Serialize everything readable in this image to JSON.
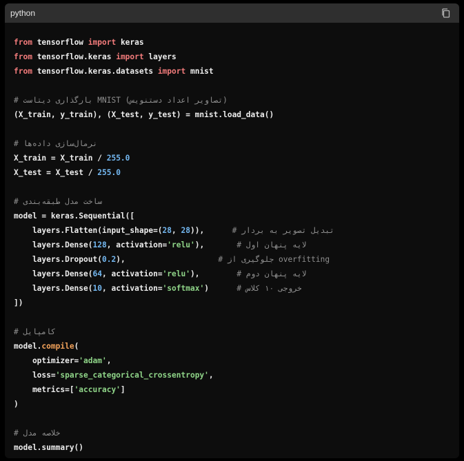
{
  "header": {
    "language": "python",
    "copy_icon": "copy-icon"
  },
  "colors": {
    "page_background": "#000000",
    "code_background": "#0d0d0d",
    "header_background": "#2f2f2f",
    "keyword": "#f27b7b",
    "number": "#73b7f0",
    "string": "#8fd488",
    "function": "#f2a25a",
    "comment": "#8f8f8f",
    "plain": "#ececec"
  },
  "code": {
    "lines": [
      [
        [
          "keyword",
          "from"
        ],
        [
          "plain",
          " tensorflow "
        ],
        [
          "keyword",
          "import"
        ],
        [
          "plain",
          " keras"
        ]
      ],
      [
        [
          "keyword",
          "from"
        ],
        [
          "plain",
          " tensorflow.keras "
        ],
        [
          "keyword",
          "import"
        ],
        [
          "plain",
          " layers"
        ]
      ],
      [
        [
          "keyword",
          "from"
        ],
        [
          "plain",
          " tensorflow.keras.datasets "
        ],
        [
          "keyword",
          "import"
        ],
        [
          "plain",
          " mnist"
        ]
      ],
      [],
      [
        [
          "comment",
          "# بارگذاری دیتاست MNIST (تصاویر اعداد دستنویس)"
        ]
      ],
      [
        [
          "plain",
          "(X_train, y_train), (X_test, y_test) = mnist.load_data()"
        ]
      ],
      [],
      [
        [
          "comment",
          "# نرمال‌سازی داده‌ها"
        ]
      ],
      [
        [
          "plain",
          "X_train = X_train / "
        ],
        [
          "number",
          "255.0"
        ]
      ],
      [
        [
          "plain",
          "X_test = X_test / "
        ],
        [
          "number",
          "255.0"
        ]
      ],
      [],
      [
        [
          "comment",
          "# ساخت مدل طبقه‌بندی"
        ]
      ],
      [
        [
          "plain",
          "model = keras.Sequential(["
        ]
      ],
      [
        [
          "plain",
          "    layers.Flatten(input_shape=("
        ],
        [
          "number",
          "28"
        ],
        [
          "plain",
          ", "
        ],
        [
          "number",
          "28"
        ],
        [
          "plain",
          ")),      "
        ],
        [
          "comment",
          "# تبدیل تصویر به بردار"
        ]
      ],
      [
        [
          "plain",
          "    layers.Dense("
        ],
        [
          "number",
          "128"
        ],
        [
          "plain",
          ", activation="
        ],
        [
          "string",
          "'relu'"
        ],
        [
          "plain",
          "),       "
        ],
        [
          "comment",
          "# لایه پنهان اول"
        ]
      ],
      [
        [
          "plain",
          "    layers.Dropout("
        ],
        [
          "number",
          "0.2"
        ],
        [
          "plain",
          "),                    "
        ],
        [
          "comment",
          "# جلوگیری از overfitting"
        ]
      ],
      [
        [
          "plain",
          "    layers.Dense("
        ],
        [
          "number",
          "64"
        ],
        [
          "plain",
          ", activation="
        ],
        [
          "string",
          "'relu'"
        ],
        [
          "plain",
          "),        "
        ],
        [
          "comment",
          "# لایه پنهان دوم"
        ]
      ],
      [
        [
          "plain",
          "    layers.Dense("
        ],
        [
          "number",
          "10"
        ],
        [
          "plain",
          ", activation="
        ],
        [
          "string",
          "'softmax'"
        ],
        [
          "plain",
          ")      "
        ],
        [
          "comment",
          "# خروجی ۱۰ کلاس"
        ]
      ],
      [
        [
          "plain",
          "])"
        ]
      ],
      [],
      [
        [
          "comment",
          "# کامپایل"
        ]
      ],
      [
        [
          "plain",
          "model."
        ],
        [
          "func",
          "compile"
        ],
        [
          "plain",
          "("
        ]
      ],
      [
        [
          "plain",
          "    optimizer="
        ],
        [
          "string",
          "'adam'"
        ],
        [
          "plain",
          ","
        ]
      ],
      [
        [
          "plain",
          "    loss="
        ],
        [
          "string",
          "'sparse_categorical_crossentropy'"
        ],
        [
          "plain",
          ","
        ]
      ],
      [
        [
          "plain",
          "    metrics=["
        ],
        [
          "string",
          "'accuracy'"
        ],
        [
          "plain",
          "]"
        ]
      ],
      [
        [
          "plain",
          ")"
        ]
      ],
      [],
      [
        [
          "comment",
          "# خلاصه مدل"
        ]
      ],
      [
        [
          "plain",
          "model.summary()"
        ]
      ]
    ]
  }
}
